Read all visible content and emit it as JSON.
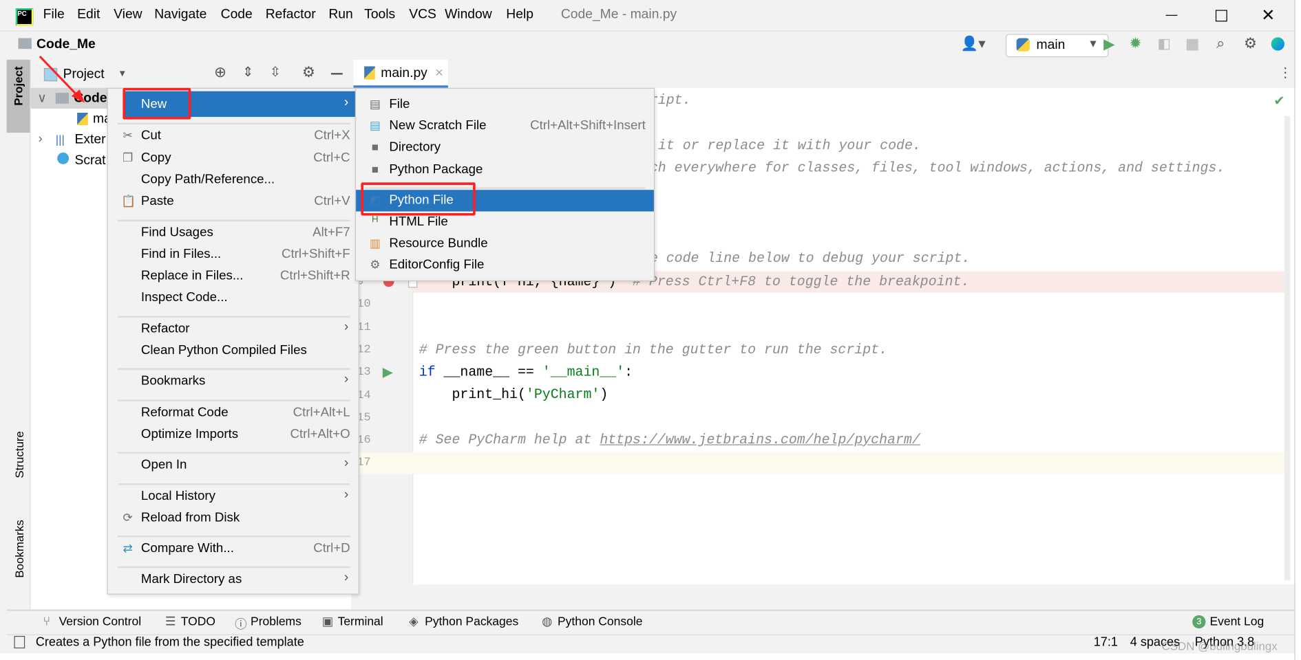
{
  "titlebar": {
    "menu": [
      "File",
      "Edit",
      "View",
      "Navigate",
      "Code",
      "Refactor",
      "Run",
      "Tools",
      "VCS",
      "Window",
      "Help"
    ],
    "title": "Code_Me - main.py"
  },
  "navbar": {
    "project": "Code_Me",
    "run_config": "main"
  },
  "project_panel": {
    "header": "Project",
    "tree": [
      "Code",
      "ma",
      "Exter",
      "Scrat"
    ]
  },
  "left_stripe": {
    "project": "Project",
    "structure": "Structure",
    "bookmarks": "Bookmarks"
  },
  "editor": {
    "tab": "main.py",
    "fragments": {
      "l1": "ript.",
      "l3": "it or replace it with your code.",
      "l4": "ch everywhere for classes, files, tool windows, actions, and settings.",
      "l8": "e code line below to debug your script.",
      "l9a": "    print(f'Hi, {name}')",
      "l9b": "  # Press Ctrl+F8 to toggle the breakpoint.",
      "l12": "# Press the green button in the gutter to run the script.",
      "l13a": "if",
      "l13b": " __name__ == ",
      "l13c": "'__main__'",
      "l13d": ":",
      "l14a": "    print_hi(",
      "l14b": "'PyCharm'",
      "l14c": ")",
      "l16a": "# See PyCharm help at ",
      "l16b": "https://www.jetbrains.com/help/pycharm/"
    },
    "line_numbers": [
      "9",
      "10",
      "11",
      "12",
      "13",
      "14",
      "15",
      "16",
      "17"
    ]
  },
  "context_menu": {
    "items": [
      {
        "label": "New",
        "shortcut": "",
        "submenu": true,
        "icon": "",
        "selected": true
      },
      {
        "sep": true
      },
      {
        "label": "Cut",
        "shortcut": "Ctrl+X",
        "icon": "scissors-icon"
      },
      {
        "label": "Copy",
        "shortcut": "Ctrl+C",
        "icon": "copy-icon"
      },
      {
        "label": "Copy Path/Reference...",
        "shortcut": ""
      },
      {
        "label": "Paste",
        "shortcut": "Ctrl+V",
        "icon": "paste-icon"
      },
      {
        "sep": true
      },
      {
        "label": "Find Usages",
        "shortcut": "Alt+F7"
      },
      {
        "label": "Find in Files...",
        "shortcut": "Ctrl+Shift+F"
      },
      {
        "label": "Replace in Files...",
        "shortcut": "Ctrl+Shift+R"
      },
      {
        "label": "Inspect Code...",
        "shortcut": ""
      },
      {
        "sep": true
      },
      {
        "label": "Refactor",
        "submenu": true
      },
      {
        "label": "Clean Python Compiled Files"
      },
      {
        "sep": true
      },
      {
        "label": "Bookmarks",
        "submenu": true
      },
      {
        "sep": true
      },
      {
        "label": "Reformat Code",
        "shortcut": "Ctrl+Alt+L"
      },
      {
        "label": "Optimize Imports",
        "shortcut": "Ctrl+Alt+O"
      },
      {
        "sep": true
      },
      {
        "label": "Open In",
        "submenu": true
      },
      {
        "sep": true
      },
      {
        "label": "Local History",
        "submenu": true
      },
      {
        "label": "Reload from Disk",
        "icon": "reload-icon"
      },
      {
        "sep": true
      },
      {
        "label": "Compare With...",
        "shortcut": "Ctrl+D",
        "icon": "compare-icon"
      },
      {
        "sep": true
      },
      {
        "label": "Mark Directory as",
        "submenu": true
      }
    ]
  },
  "submenu": {
    "items": [
      {
        "label": "File",
        "icon": "file-icon"
      },
      {
        "label": "New Scratch File",
        "shortcut": "Ctrl+Alt+Shift+Insert",
        "icon": "scratch-file-icon"
      },
      {
        "label": "Directory",
        "icon": "folder-icon"
      },
      {
        "label": "Python Package",
        "icon": "package-icon"
      },
      {
        "sep": true
      },
      {
        "label": "Python File",
        "icon": "python-file-icon",
        "selected": true
      },
      {
        "label": "HTML File",
        "icon": "html-file-icon"
      },
      {
        "label": "Resource Bundle",
        "icon": "resource-bundle-icon"
      },
      {
        "label": "EditorConfig File",
        "icon": "editorconfig-icon"
      }
    ]
  },
  "toolwindows": {
    "left": [
      "Version Control",
      "TODO",
      "Problems",
      "Terminal",
      "Python Packages",
      "Python Console"
    ],
    "event_log": "Event Log",
    "event_count": "3"
  },
  "statusbar": {
    "message": "Creates a Python file from the specified template",
    "position": "17:1",
    "indent": "4 spaces",
    "interpreter": "Python 3.8"
  },
  "watermark": "CSDN @bulingbulingx",
  "colors": {
    "selection": "#2675bf",
    "highlight_box": "#ff2020",
    "run_green": "#59a869",
    "breakpoint_red": "#e55454"
  }
}
